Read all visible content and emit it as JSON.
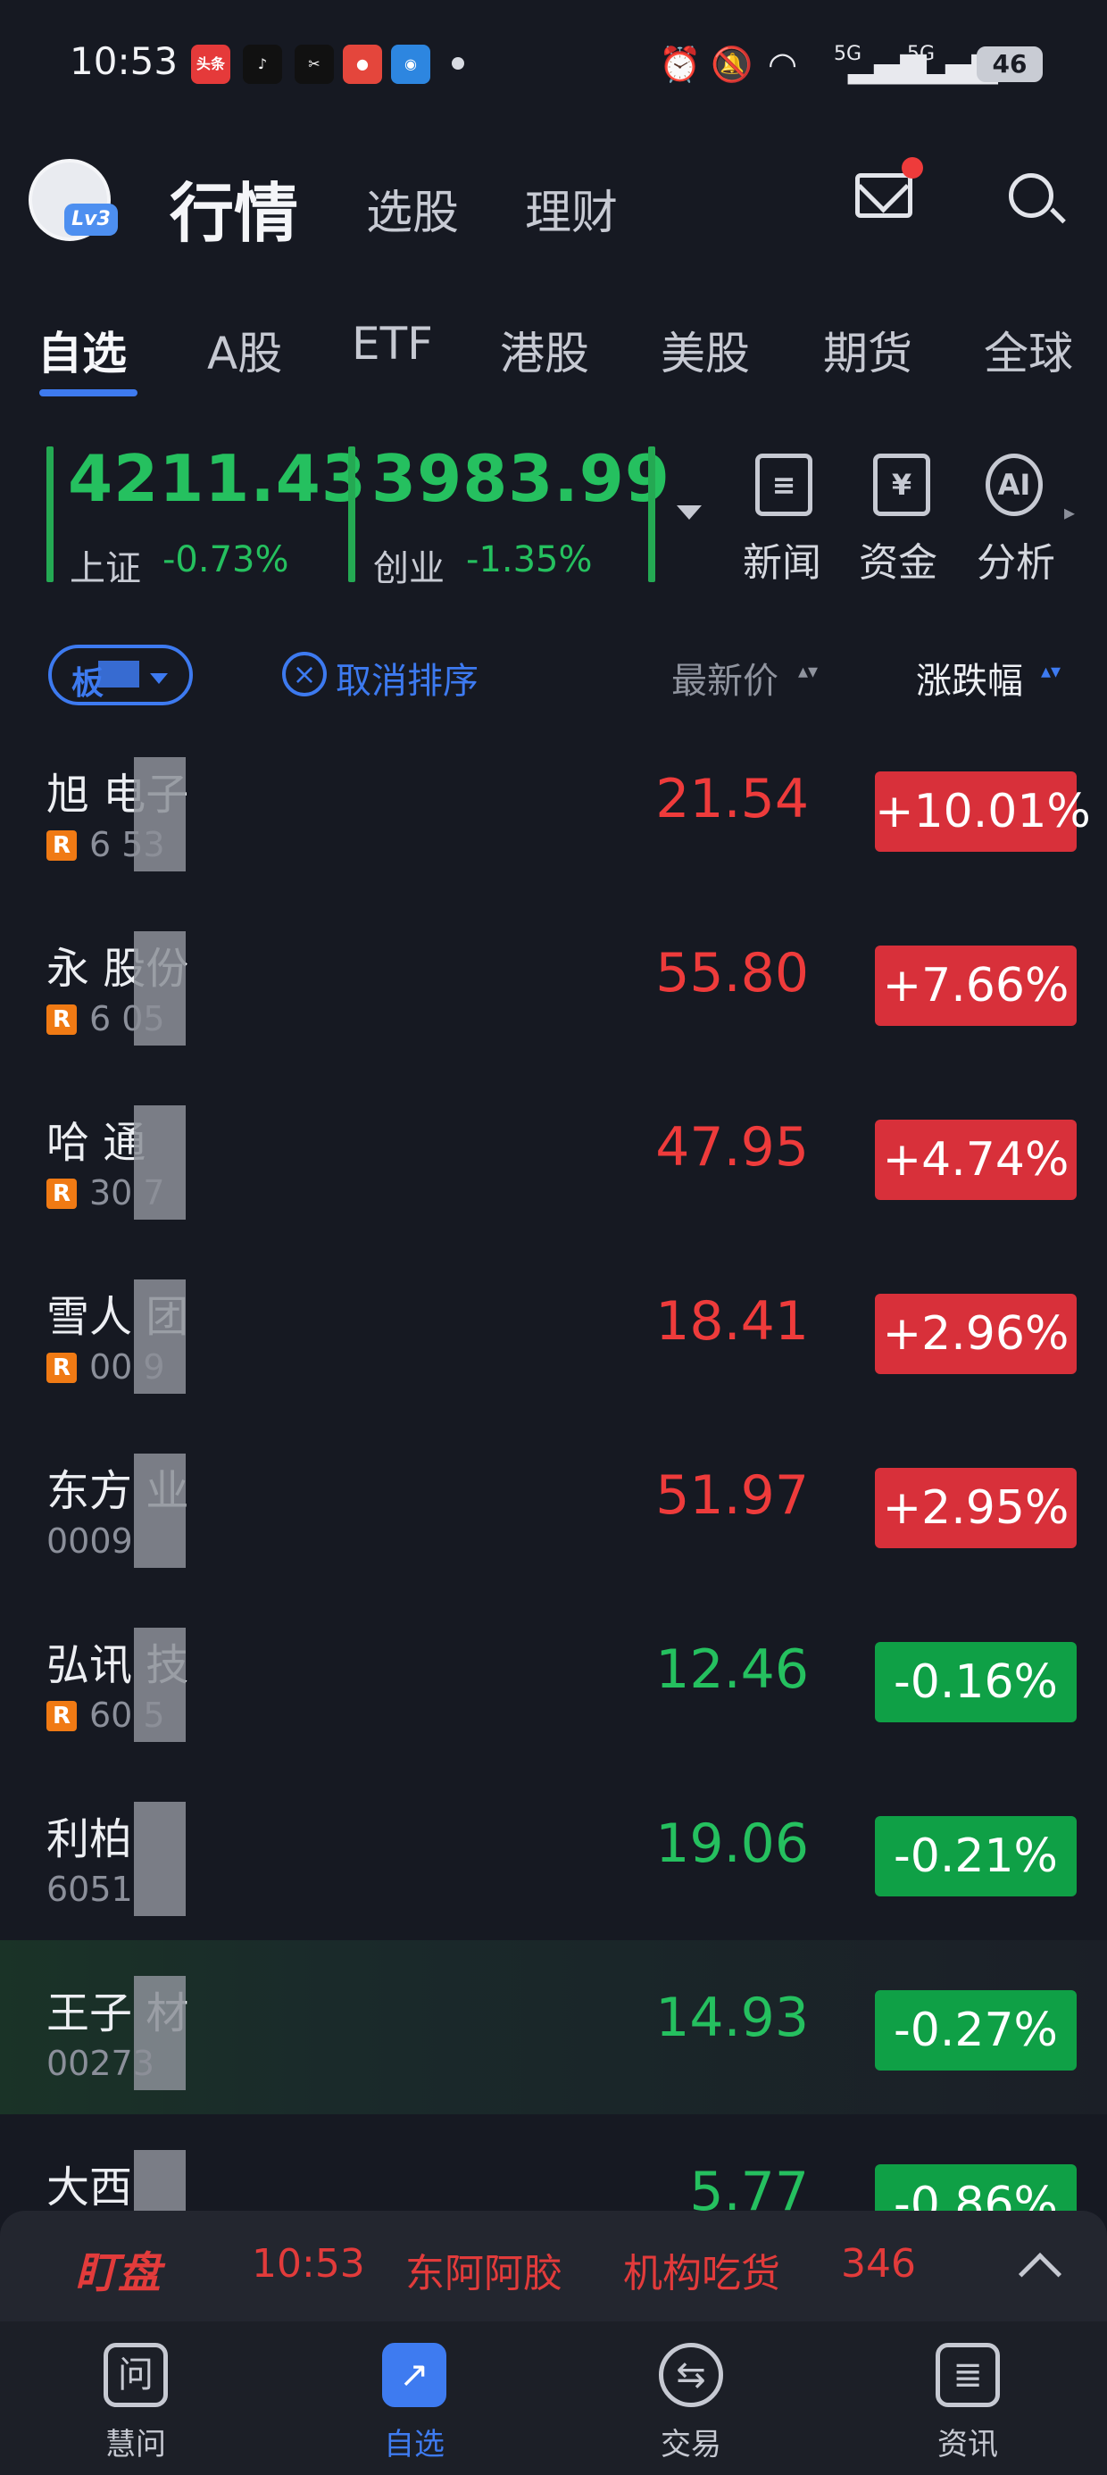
{
  "status_bar": {
    "time": "10:53",
    "app_icons": [
      "头条",
      "tiktok-icon",
      "capcut-icon",
      "app-icon",
      "app-icon"
    ],
    "network1": "5G",
    "network2": "5G",
    "battery": "46"
  },
  "header": {
    "level_badge": "Lv3",
    "title": "行情",
    "links": [
      "选股",
      "理财"
    ]
  },
  "market_tabs": [
    "自选",
    "A股",
    "ETF",
    "港股",
    "美股",
    "期货",
    "全球"
  ],
  "indices": [
    {
      "value": "4211.43",
      "name": "上证",
      "change": "-0.73%"
    },
    {
      "value": "3983.99",
      "name": "创业",
      "change": "-1.35%"
    }
  ],
  "tools": [
    {
      "label": "新闻",
      "icon": "news-icon"
    },
    {
      "label": "资金",
      "icon": "funds-icon"
    },
    {
      "label": "分析",
      "icon": "ai-analysis-icon"
    }
  ],
  "list_header": {
    "group_pill": "板",
    "cancel_sort": "取消排序",
    "col_price": "最新价",
    "col_change": "涨跌幅"
  },
  "stocks": [
    {
      "name": "旭  电子",
      "badge": "R",
      "code": "6   53",
      "price": "21.54",
      "change": "+10.01%",
      "dir": "up"
    },
    {
      "name": "永  股份",
      "badge": "R",
      "code": "6   05",
      "price": "55.80",
      "change": "+7.66%",
      "dir": "up"
    },
    {
      "name": "哈    通",
      "badge": "R",
      "code": "30   7",
      "price": "47.95",
      "change": "+4.74%",
      "dir": "up"
    },
    {
      "name": "雪人  团",
      "badge": "R",
      "code": "00   9",
      "price": "18.41",
      "change": "+2.96%",
      "dir": "up"
    },
    {
      "name": "东方  业",
      "badge": "",
      "code": "0009",
      "price": "51.97",
      "change": "+2.95%",
      "dir": "up"
    },
    {
      "name": "弘讯  技",
      "badge": "R",
      "code": "60   5",
      "price": "12.46",
      "change": "-0.16%",
      "dir": "dn"
    },
    {
      "name": "利柏",
      "badge": "",
      "code": "6051",
      "price": "19.06",
      "change": "-0.21%",
      "dir": "dn"
    },
    {
      "name": "王子  材",
      "badge": "",
      "code": "00273",
      "price": "14.93",
      "change": "-0.27%",
      "dir": "dn"
    },
    {
      "name": "大西",
      "badge": "",
      "code": "",
      "price": "5.77",
      "change": "-0.86%",
      "dir": "dn"
    }
  ],
  "ticker": {
    "logo": "盯盘",
    "time": "10:53",
    "stock": "东阿阿胶",
    "tag": "机构吃货",
    "volume": "346"
  },
  "bottom_nav": [
    {
      "label": "慧问",
      "icon": "ask-icon",
      "active": false
    },
    {
      "label": "自选",
      "icon": "watchlist-chart-icon",
      "active": true
    },
    {
      "label": "交易",
      "icon": "trade-exchange-icon",
      "active": false
    },
    {
      "label": "资讯",
      "icon": "info-doc-icon",
      "active": false
    }
  ],
  "colors": {
    "up": "#ee3b3b",
    "down": "#25c05f",
    "accent": "#3e7bf0",
    "background": "#161922"
  }
}
